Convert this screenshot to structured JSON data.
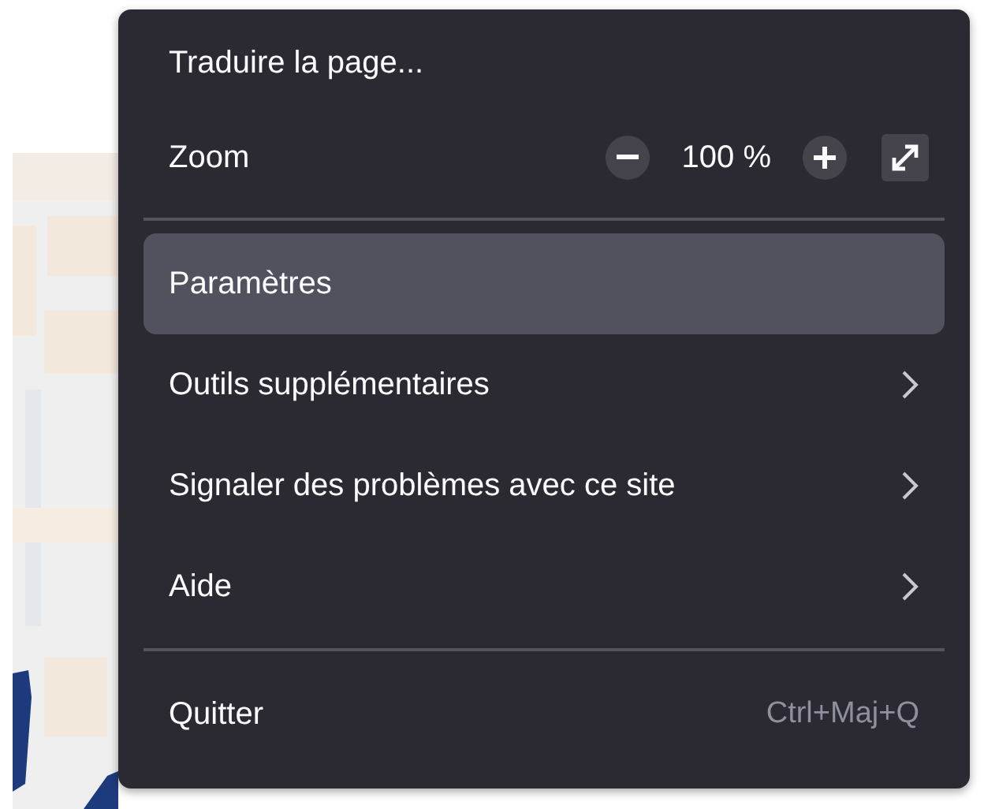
{
  "menu": {
    "items": [
      {
        "kind": "action",
        "label": "Traduire la page...",
        "selected": false
      },
      {
        "kind": "zoom",
        "label": "Zoom",
        "value": "100 %"
      },
      {
        "kind": "separator"
      },
      {
        "kind": "action",
        "label": "Paramètres",
        "selected": true
      },
      {
        "kind": "submenu",
        "label": "Outils supplémentaires",
        "selected": false
      },
      {
        "kind": "submenu",
        "label": "Signaler des problèmes avec ce site",
        "selected": false
      },
      {
        "kind": "submenu",
        "label": "Aide",
        "selected": false
      },
      {
        "kind": "separator"
      },
      {
        "kind": "action",
        "label": "Quitter",
        "shortcut": "Ctrl+Maj+Q",
        "selected": false
      }
    ]
  }
}
